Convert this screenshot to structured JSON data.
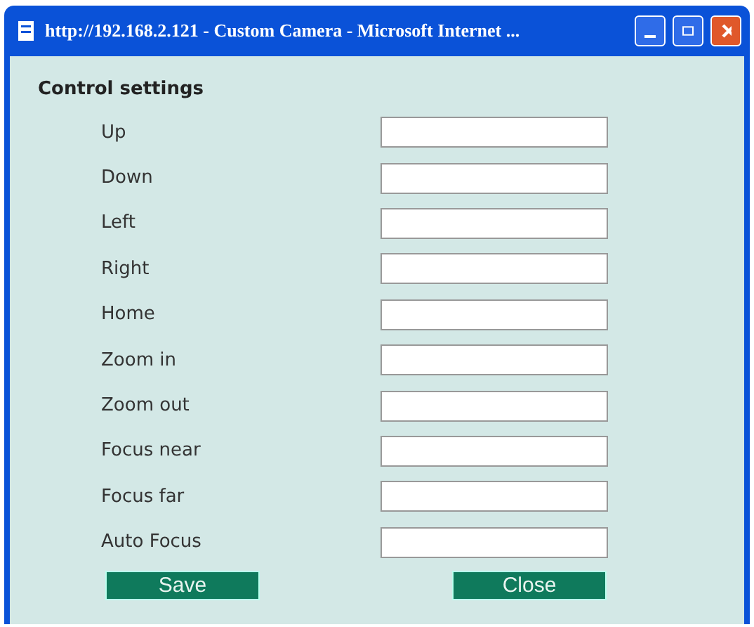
{
  "window": {
    "title": "http://192.168.2.121 - Custom Camera - Microsoft Internet ..."
  },
  "heading": "Control settings",
  "fields": [
    {
      "label": "Up"
    },
    {
      "label": "Down"
    },
    {
      "label": "Left"
    },
    {
      "label": "Right"
    },
    {
      "label": "Home"
    },
    {
      "label": "Zoom in"
    },
    {
      "label": "Zoom out"
    },
    {
      "label": "Focus near"
    },
    {
      "label": "Focus far"
    },
    {
      "label": "Auto Focus"
    }
  ],
  "buttons": [
    "Save",
    "Close"
  ]
}
